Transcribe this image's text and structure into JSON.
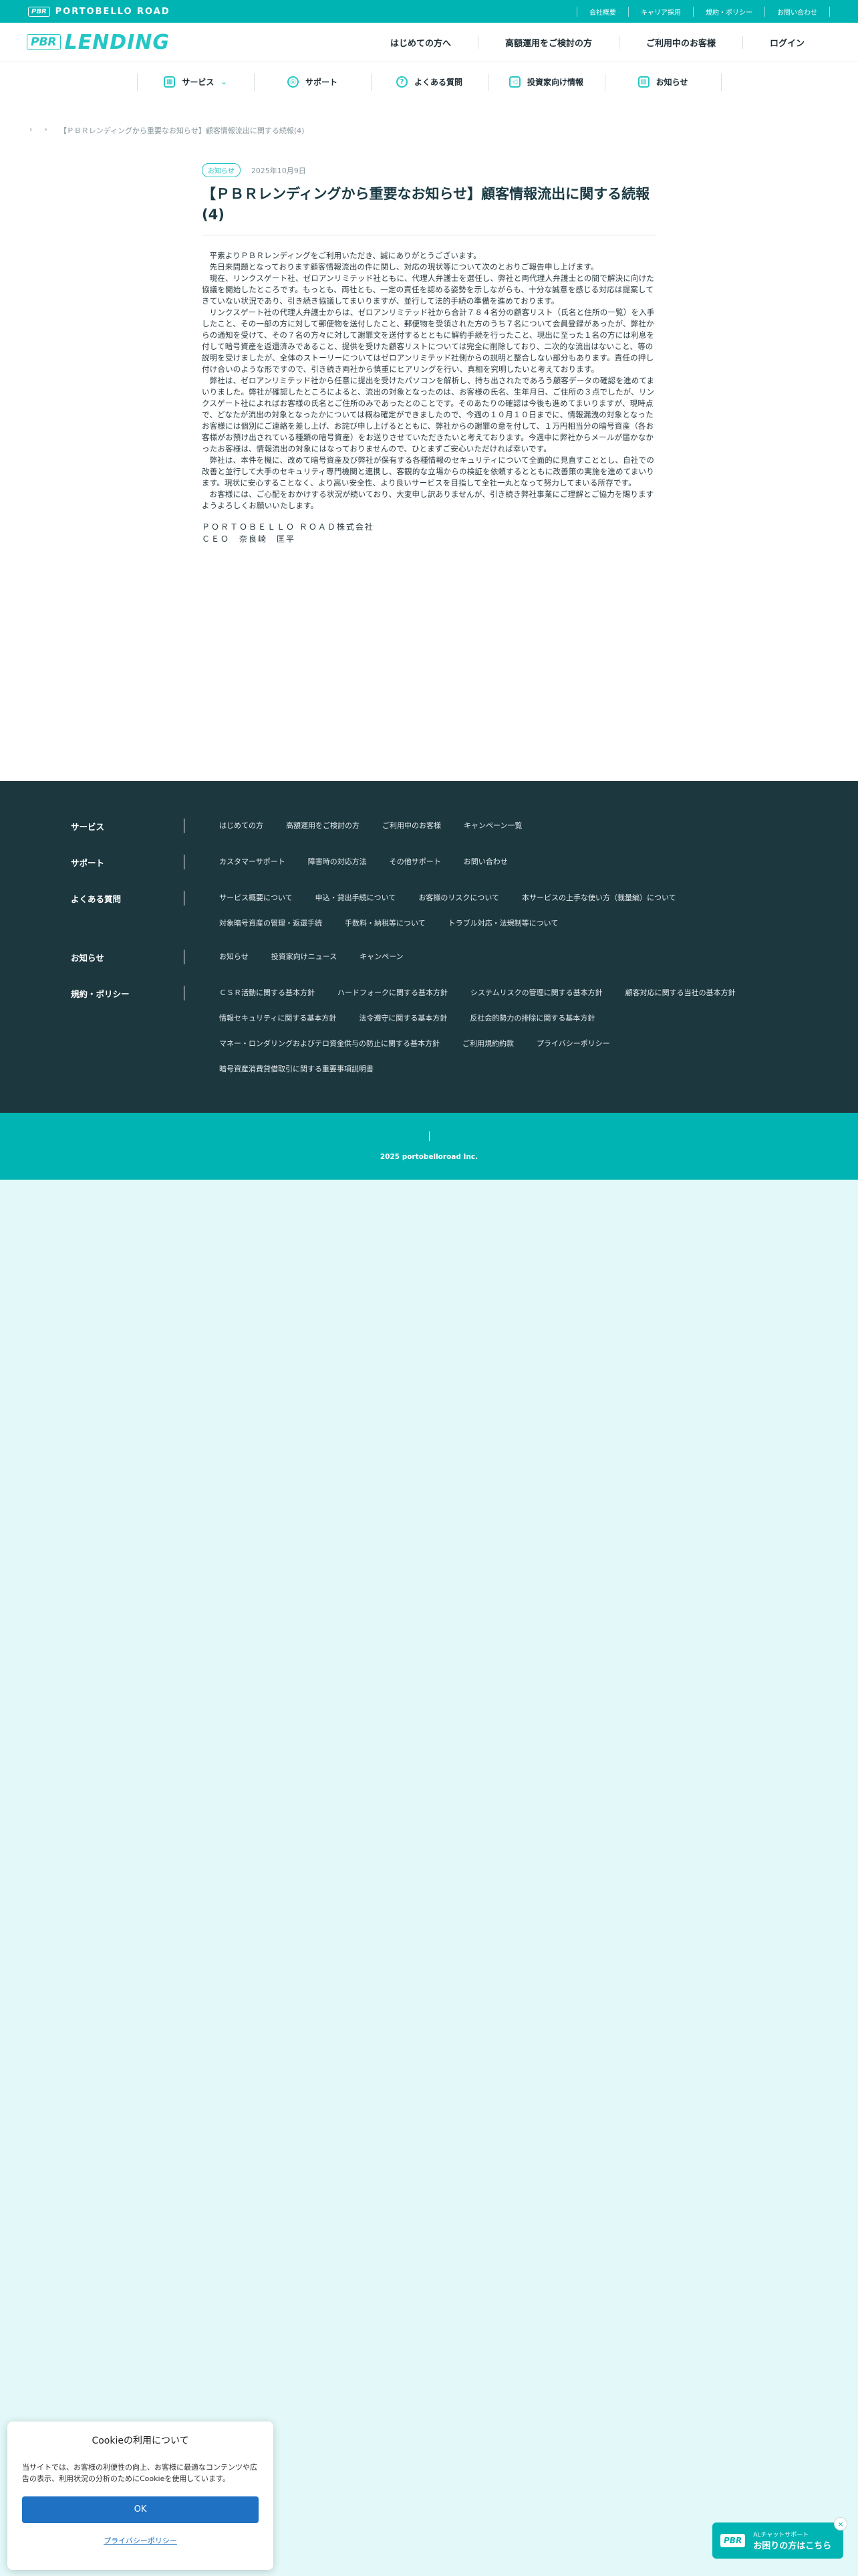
{
  "topbar": {
    "brand": "PORTOBELLO ROAD",
    "badge": "PBR",
    "links": [
      "会社概要",
      "キャリア採用",
      "規約・ポリシー",
      "お問い合わせ"
    ]
  },
  "header": {
    "logo_text": "LENDING",
    "logo_badge": "PBR",
    "nav": [
      "はじめての方へ",
      "高額運用をご検討の方",
      "ご利用中のお客様",
      "ログイン"
    ]
  },
  "subnav": [
    {
      "label": "サービス",
      "icon": "grid-icon"
    },
    {
      "label": "サポート",
      "icon": "support-icon"
    },
    {
      "label": "よくある質問",
      "icon": "question-icon"
    },
    {
      "label": "投資家向け情報",
      "icon": "megaphone-icon"
    },
    {
      "label": "お知らせ",
      "icon": "notice-icon"
    }
  ],
  "breadcrumb": {
    "current": "【ＰＢＲレンディングから重要なお知らせ】顧客情報流出に関する続報(4)"
  },
  "article": {
    "tag": "お知らせ",
    "date": "2025年10月9日",
    "title": "【ＰＢＲレンディングから重要なお知らせ】顧客情報流出に関する続報(4)",
    "greeting": "平素よりＰＢＲレンディングをご利用いただき、誠にありがとうございます。",
    "paragraphs": [
      "先日来問題となっております顧客情報流出の件に関し、対応の現状等について次のとおりご報告申し上げます。",
      "現在、リンクスゲート社、ゼロアンリミテッド社ともに、代理人弁護士を選任し、弊社と両代理人弁護士との間で解決に向けた協議を開始したところです。もっとも、両社とも、一定の責任を認める姿勢を示しながらも、十分な誠意を感じる対応は提案してきていない状況であり、引き続き協議してまいりますが、並行して法的手続の準備を進めております。",
      "リンクスゲート社の代理人弁護士からは、ゼロアンリミテッド社から合計７８４名分の顧客リスト（氏名と住所の一覧）を入手したこと、その一部の方に対して郵便物を送付したこと、郵便物を受領された方のうち７名について会員登録があったが、弊社からの通知を受けて、その７名の方々に対して謝罪文を送付するとともに解約手続を行ったこと、現出に至った１名の方には利息を付して暗号資産を返還済みであること、提供を受けた顧客リストについては完全に削除しており、二次的な流出はないこと、等の説明を受けましたが、全体のストーリーについてはゼロアンリミテッド社側からの説明と整合しない部分もあります。責任の押し付け合いのような形ですので、引き続き両社から慎重にヒアリングを行い、真相を究明したいと考えております。",
      "弊社は、ゼロアンリミテッド社から任意に提出を受けたパソコンを解析し、持ち出されたであろう顧客データの確認を進めてまいりました。弊社が確認したところによると、流出の対象となったのは、お客様の氏名、生年月日、ご住所の３点でしたが、リンクスゲート社によればお客様の氏名とご住所のみであったとのことです。そのあたりの確認は今後も進めてまいりますが、現時点で、どなたが流出の対象となったかについては概ね確定ができましたので、今週の１０月１０日までに、情報漏洩の対象となったお客様には個別にご連絡を差し上げ、お詫び申し上げるとともに、弊社からの謝罪の意を付して、１万円相当分の暗号資産（各お客様がお預け出されている種類の暗号資産）をお送りさせていただきたいと考えております。今週中に弊社からメールが届かなかったお客様は、情報流出の対象にはなっておりませんので、ひとまずご安心いただければ幸いです。",
      "弊社は、本件を機に、改めて暗号資産及び弊社が保有する各種情報のセキュリティについて全面的に見直すこととし、自社での改善と並行して大手のセキュリティ専門機関と連携し、客観的な立場からの検証を依頼するとともに改善策の実施を進めてまいります。現状に安心することなく、より高い安全性、より良いサービスを目指して全社一丸となって努力してまいる所存です。",
      "お客様には、ご心配をおかけする状況が続いており、大変申し訳ありませんが、引き続き弊社事業にご理解とご協力を賜りますようよろしくお願いいたします。"
    ],
    "sign_company": "ＰＯＲＴＯＢＥＬＬＯ ＲＯＡＤ株式会社",
    "sign_ceo": "ＣＥＯ　奈良崎　匡平"
  },
  "footer": {
    "sections": [
      {
        "label": "サービス",
        "links": [
          "はじめての方",
          "高額運用をご検討の方",
          "ご利用中のお客様",
          "キャンペーン一覧"
        ]
      },
      {
        "label": "サポート",
        "links": [
          "カスタマーサポート",
          "障害時の対応方法",
          "その他サポート",
          "お問い合わせ"
        ]
      },
      {
        "label": "よくある質問",
        "links": [
          "サービス概要について",
          "申込・貸出手続について",
          "お客様のリスクについて",
          "本サービスの上手な使い方（裁量編）について",
          "対象暗号資産の管理・返還手続",
          "手数料・納税等について",
          "トラブル対応・法規制等について"
        ]
      },
      {
        "label": "お知らせ",
        "links": [
          "お知らせ",
          "投資家向けニュース",
          "キャンペーン"
        ]
      },
      {
        "label": "規約・ポリシー",
        "links": [
          "ＣＳＲ活動に関する基本方針",
          "ハードフォークに関する基本方針",
          "システムリスクの管理に関する基本方針",
          "顧客対応に関する当社の基本方針",
          "情報セキュリティに関する基本方針",
          "法令遵守に関する基本方針",
          "反社会的勢力の排除に関する基本方針",
          "ご利用規約約款",
          "マネー・ロンダリングおよびテロ資金供与の防止に関する基本方針",
          "プライバシーポリシー",
          "暗号資産消費貸借取引に関する重要事項説明書"
        ]
      }
    ],
    "copyright": "2025 portobelloroad Inc."
  },
  "cookie": {
    "title": "Cookieの利用について",
    "text": "当サイトでは、お客様の利便性の向上、お客様に最適なコンテンツや広告の表示、利用状況の分析のためにCookieを使用しています。",
    "ok": "OK",
    "policy": "プライバシーポリシー"
  },
  "support_widget": {
    "badge": "PBR",
    "line1": "ALチャットサポート",
    "line2": "お困りの方はこちら",
    "close": "×"
  },
  "colors": {
    "accent": "#00b4b4",
    "footer_bg": "#1d373f",
    "page_bg": "#e3f8f8",
    "ok_button": "#1e71c3"
  }
}
